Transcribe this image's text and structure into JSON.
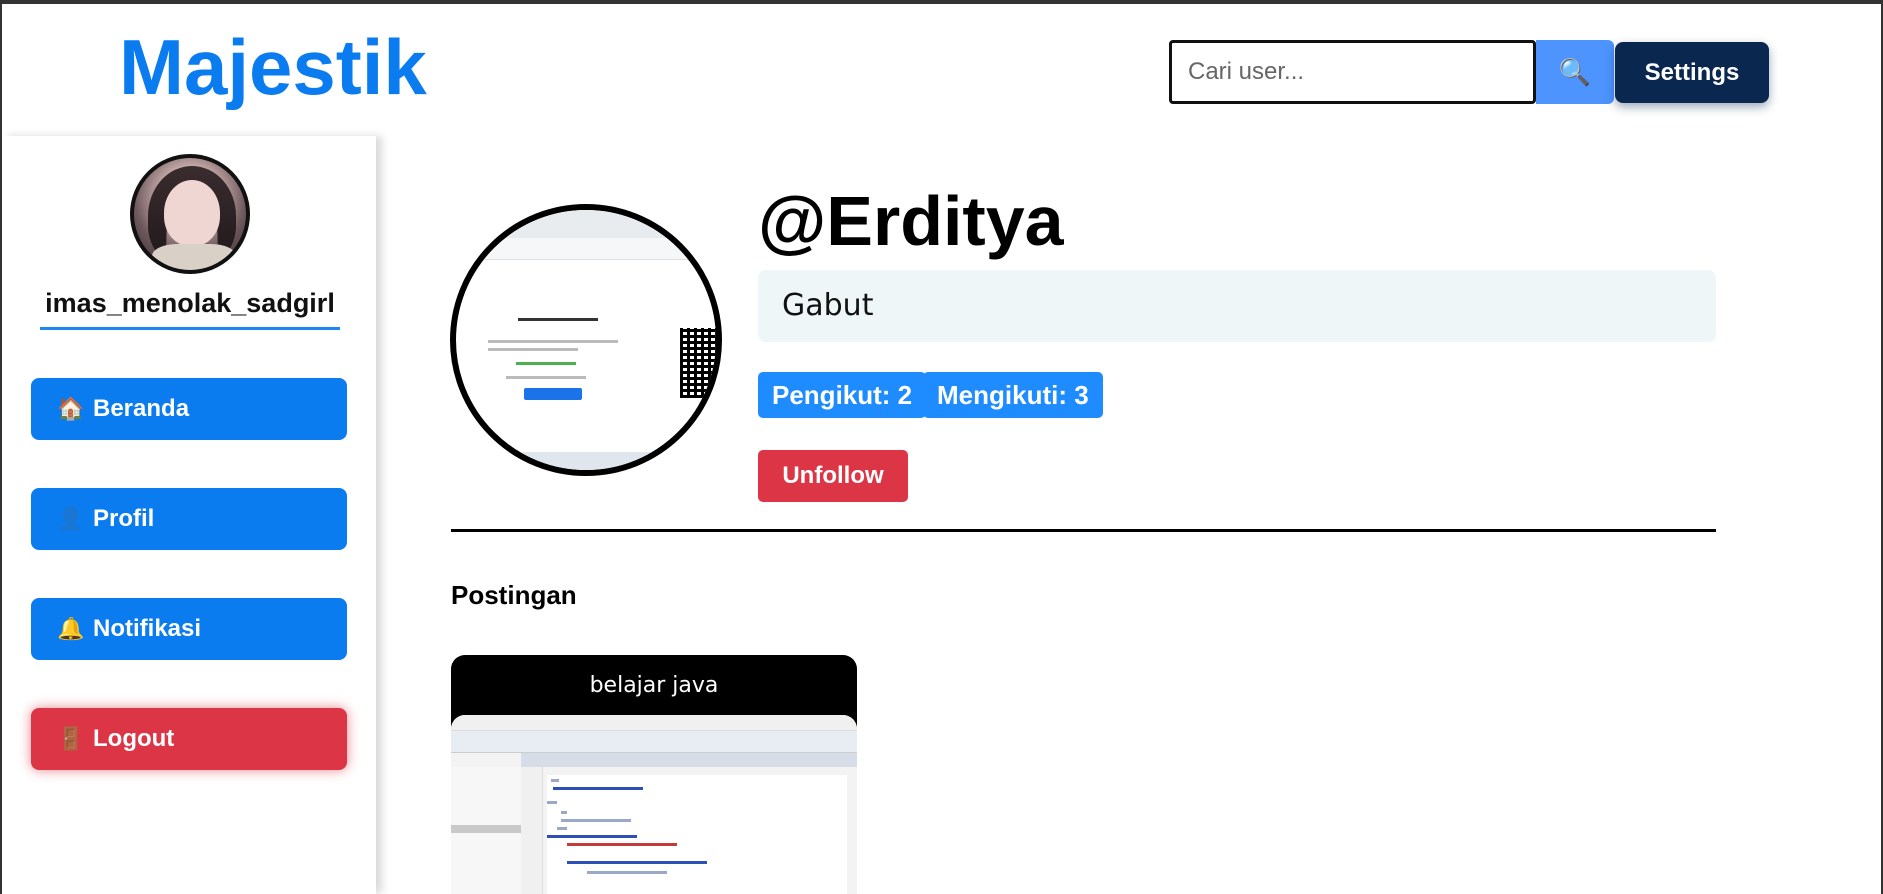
{
  "app": {
    "logo": "Majestik"
  },
  "header": {
    "search_placeholder": "Cari user...",
    "search_icon": "🔍",
    "settings_label": "Settings"
  },
  "sidebar": {
    "username": "imas_menolak_sadgirl",
    "items": [
      {
        "icon": "🏠",
        "label": "Beranda"
      },
      {
        "icon": "👤",
        "label": "Profil"
      },
      {
        "icon": "🔔",
        "label": "Notifikasi"
      },
      {
        "icon": "🚪",
        "label": "Logout"
      }
    ]
  },
  "profile": {
    "handle": "@Erditya",
    "bio": "Gabut",
    "followers_label": "Pengikut: 2",
    "following_label": "Mengikuti: 3",
    "unfollow_label": "Unfollow"
  },
  "posts": {
    "section_title": "Postingan",
    "items": [
      {
        "caption": "belajar java"
      }
    ]
  },
  "colors": {
    "brand_blue": "#0a7cf0",
    "danger_red": "#dc3545",
    "settings_navy": "#0a2750",
    "stat_blue": "#1e8cff"
  }
}
